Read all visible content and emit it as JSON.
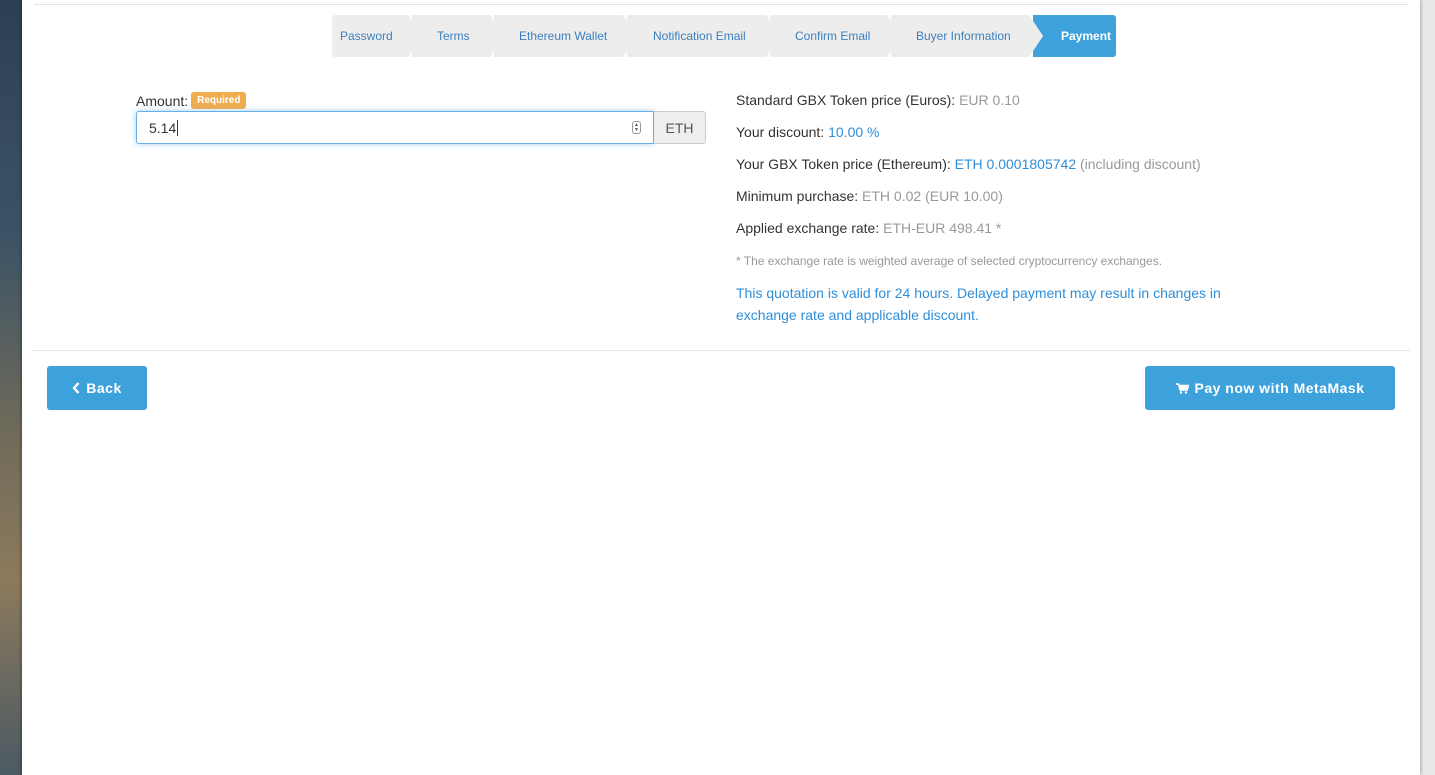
{
  "wizard": {
    "steps": [
      {
        "label": "Password"
      },
      {
        "label": "Terms"
      },
      {
        "label": "Ethereum Wallet"
      },
      {
        "label": "Notification Email"
      },
      {
        "label": "Confirm Email"
      },
      {
        "label": "Buyer Information"
      },
      {
        "label": "Payment"
      }
    ],
    "active_step": "Payment"
  },
  "form": {
    "amount_label": "Amount:",
    "required_badge": "Required",
    "amount_value": "5.14",
    "currency_addon": "ETH"
  },
  "info": {
    "standard_price_label": "Standard GBX Token price (Euros):",
    "standard_price_value": "EUR 0.10",
    "discount_label": "Your discount:",
    "discount_value": "10.00 %",
    "eth_price_label": "Your GBX Token price (Ethereum):",
    "eth_price_value": "ETH 0.0001805742",
    "eth_price_note": "(including discount)",
    "min_purchase_label": "Minimum purchase:",
    "min_purchase_value": "ETH 0.02",
    "min_purchase_eur": "(EUR 10.00)",
    "exchange_rate_label": "Applied exchange rate:",
    "exchange_rate_value": "ETH-EUR 498.41 *",
    "footnote": "* The exchange rate is weighted average of selected cryptocurrency exchanges.",
    "notice": "This quotation is valid for 24 hours. Delayed payment may result in changes in exchange rate and applicable discount."
  },
  "actions": {
    "back_label": "Back",
    "pay_label": "Pay now with MetaMask"
  },
  "icons": {
    "back": "chevron-left-icon",
    "pay": "shopping-cart-icon"
  },
  "colors": {
    "accent": "#3da1dc",
    "badge": "#f0ad4e",
    "link_blue": "#2f8ed8",
    "muted": "#999999"
  }
}
